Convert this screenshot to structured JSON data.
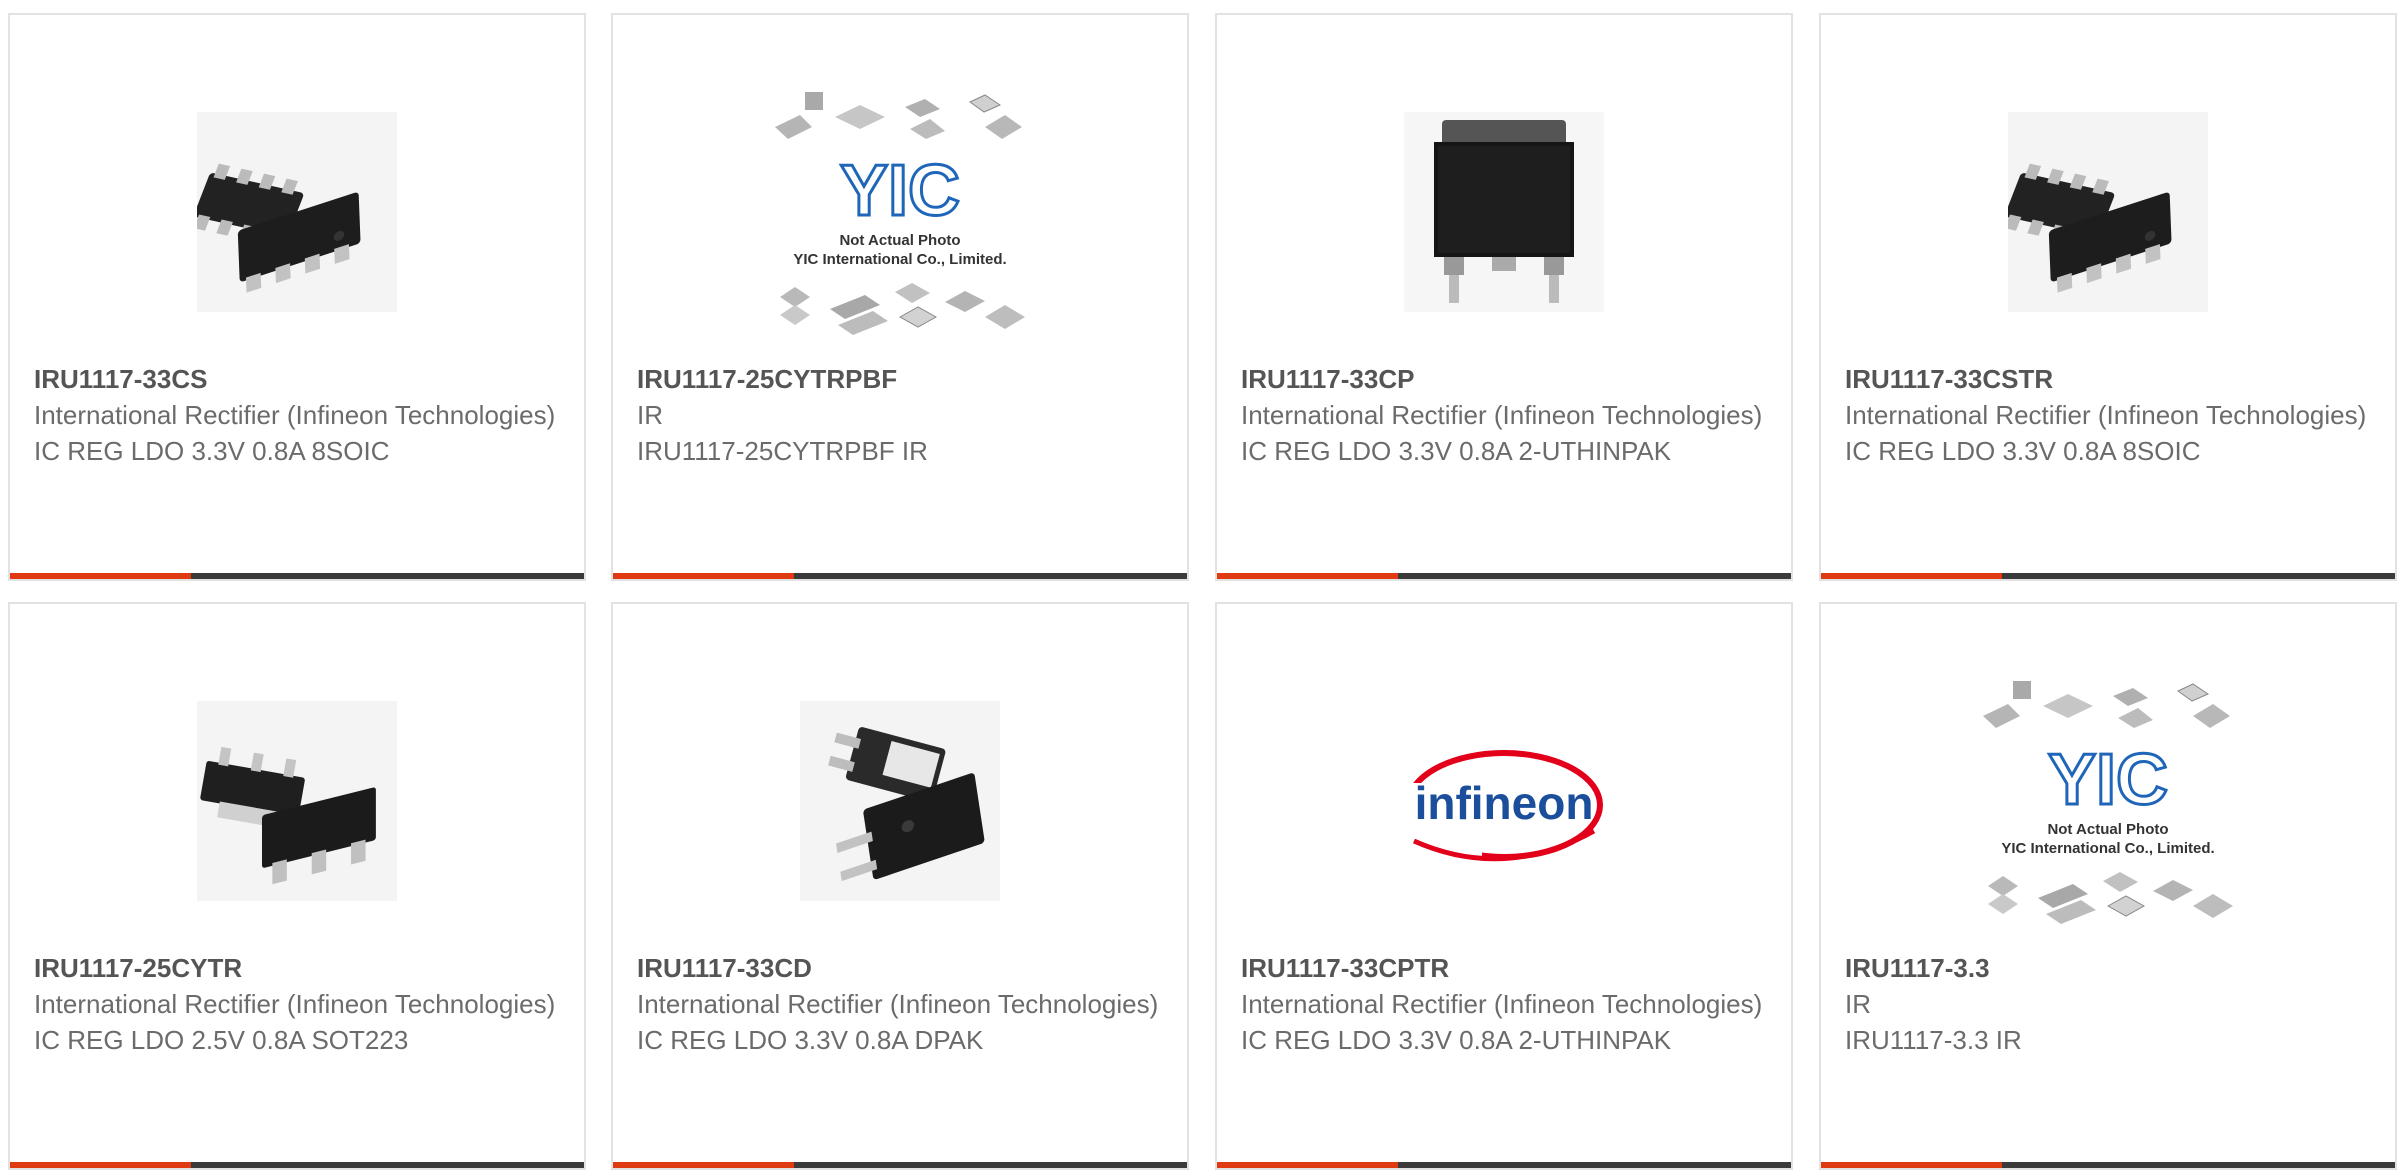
{
  "products": [
    {
      "part_number": "IRU1117-33CS",
      "manufacturer": "International Rectifier (Infineon Technologies)",
      "description": "IC REG LDO 3.3V 0.8A 8SOIC",
      "image_icon": "soic-8-package-icon"
    },
    {
      "part_number": "IRU1117-25CYTRPBF",
      "manufacturer": "IR",
      "description": "IRU1117-25CYTRPBF IR",
      "image_icon": "yic-placeholder-icon",
      "image_caption_line1": "Not Actual Photo",
      "image_caption_line2": "YIC International Co., Limited.",
      "image_logo_text": "YIC"
    },
    {
      "part_number": "IRU1117-33CP",
      "manufacturer": "International Rectifier (Infineon Technologies)",
      "description": "IC REG LDO 3.3V 0.8A 2-UTHINPAK",
      "image_icon": "to252-package-icon"
    },
    {
      "part_number": "IRU1117-33CSTR",
      "manufacturer": "International Rectifier (Infineon Technologies)",
      "description": "IC REG LDO 3.3V 0.8A 8SOIC",
      "image_icon": "soic-8-package-icon"
    },
    {
      "part_number": "IRU1117-25CYTR",
      "manufacturer": "International Rectifier (Infineon Technologies)",
      "description": "IC REG LDO 2.5V 0.8A SOT223",
      "image_icon": "sot223-package-icon"
    },
    {
      "part_number": "IRU1117-33CD",
      "manufacturer": "International Rectifier (Infineon Technologies)",
      "description": "IC REG LDO 3.3V 0.8A DPAK",
      "image_icon": "dpak-package-icon"
    },
    {
      "part_number": "IRU1117-33CPTR",
      "manufacturer": "International Rectifier (Infineon Technologies)",
      "description": "IC REG LDO 3.3V 0.8A 2-UTHINPAK",
      "image_icon": "infineon-logo-icon",
      "image_logo_text": "infineon"
    },
    {
      "part_number": "IRU1117-3.3",
      "manufacturer": "IR",
      "description": "IRU1117-3.3 IR",
      "image_icon": "yic-placeholder-icon",
      "image_caption_line1": "Not Actual Photo",
      "image_caption_line2": "YIC International Co., Limited.",
      "image_logo_text": "YIC"
    }
  ],
  "colors": {
    "accent": "#e03a12",
    "bar": "#3a3a3a",
    "border": "#e2e2e2",
    "title_text": "#555555",
    "body_text": "#6b6b6b",
    "yic_blue": "#1f66b8",
    "infineon_blue": "#1b4f9c",
    "infineon_red": "#e2001a"
  }
}
